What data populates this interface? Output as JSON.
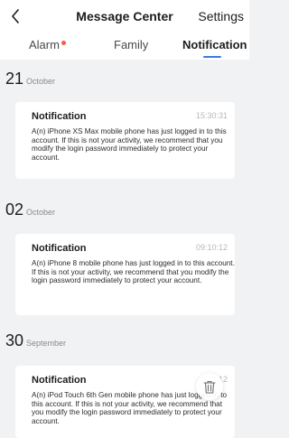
{
  "header": {
    "back_icon": "chevron-left-icon",
    "title": "Message Center",
    "settings_label": "Settings"
  },
  "tabs": [
    {
      "label": "Alarm",
      "badge": true,
      "active": false
    },
    {
      "label": "Family",
      "active": false
    },
    {
      "label": "Notification",
      "active": true
    }
  ],
  "colors": {
    "accent": "#3a7be0",
    "badge": "#ff5a3c",
    "background": "#f1f2f4"
  },
  "groups": [
    {
      "day": "21",
      "month": "October",
      "card": {
        "title": "Notification",
        "time": "15:30:31",
        "body": "A(n) iPhone XS Max mobile phone has just logged in to this account. If this is not your activity, we recommend that you modify the login password immediately to protect your account."
      }
    },
    {
      "day": "02",
      "month": "October",
      "card": {
        "title": "Notification",
        "time": "09:10:12",
        "body": "A(n) iPhone 8 mobile phone has just logged in to this account. If this is not your activity, we recommend that you modify the login password immediately to protect your account."
      }
    },
    {
      "day": "30",
      "month": "September",
      "card": {
        "title": "Notification",
        "time": "12",
        "body": "A(n) iPod Touch 6th Gen mobile phone has just logged in to this account. If this is not your activity, we recommend that you modify the login password immediately to protect your account."
      }
    }
  ],
  "floating_action": {
    "icon": "trash-icon"
  }
}
